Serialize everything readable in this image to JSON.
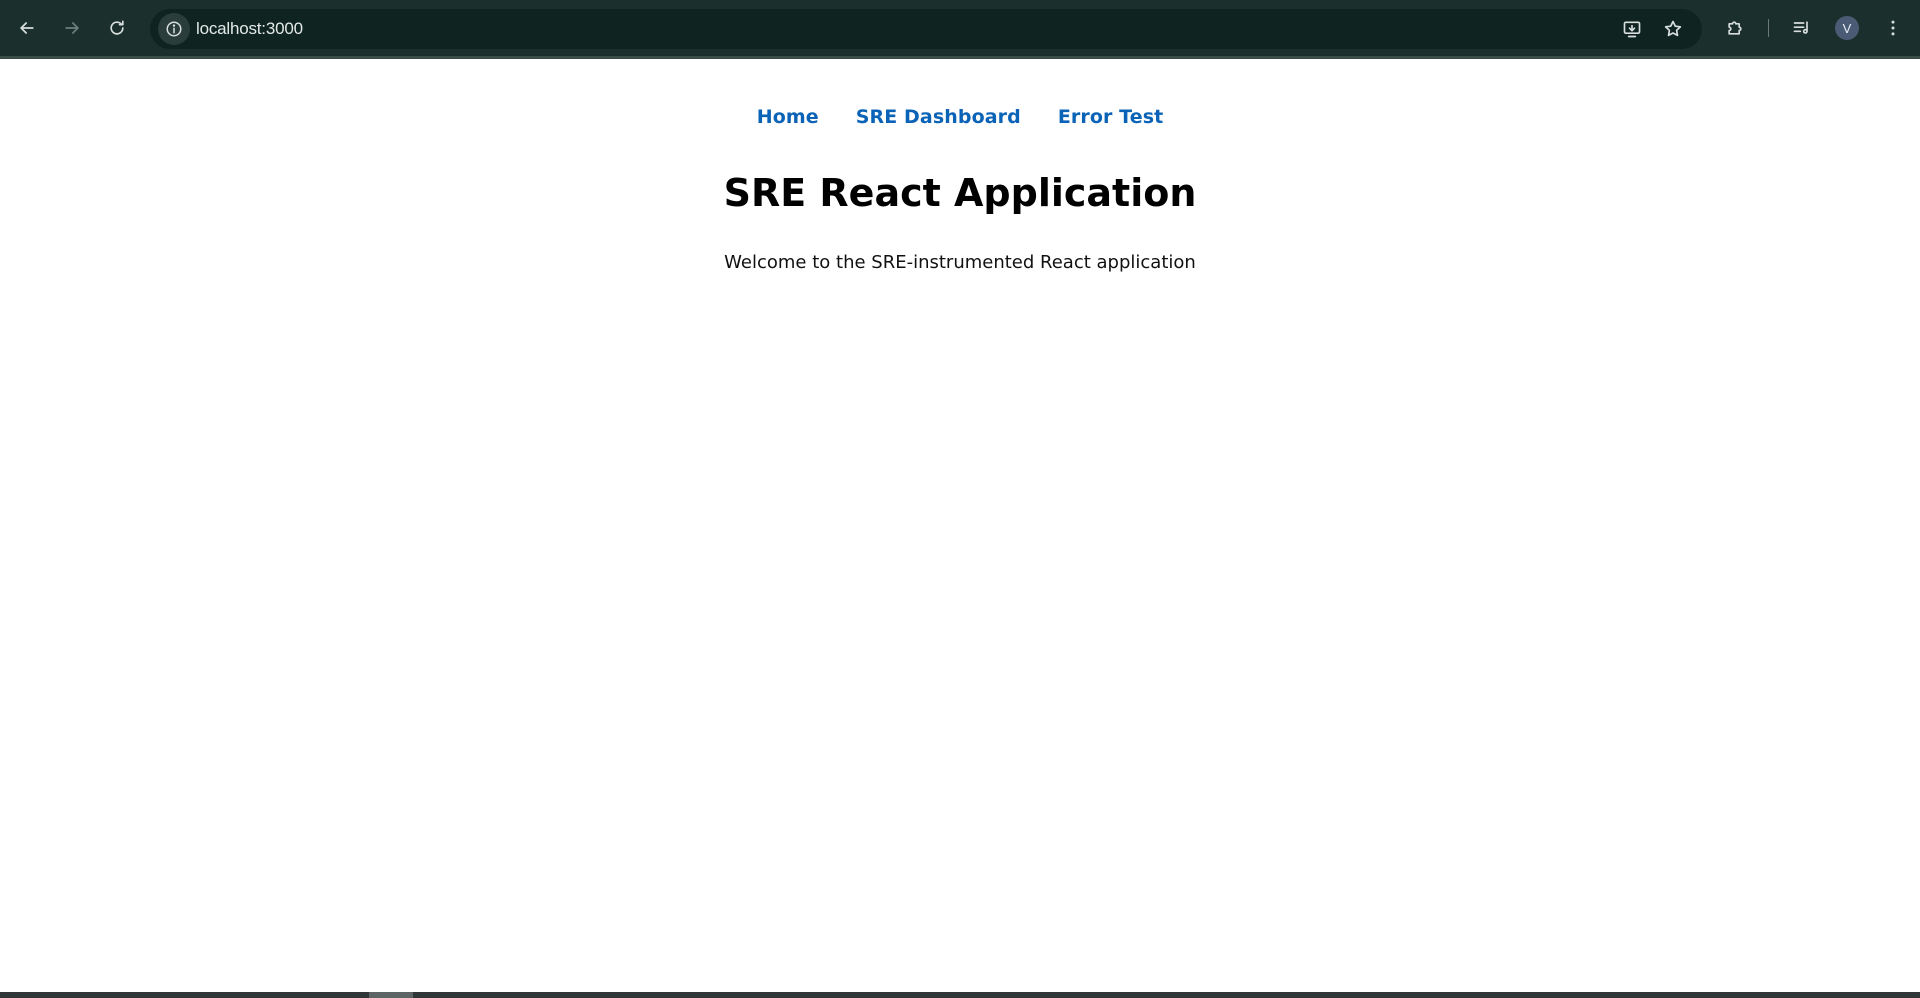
{
  "browser": {
    "url": "localhost:3000",
    "avatar_letter": "V",
    "colors": {
      "toolbar": "#1b2f2c",
      "omnibox": "#0f2421",
      "icon": "#d7dedc",
      "icon_disabled": "#6e7f7c"
    }
  },
  "app": {
    "nav": [
      {
        "label": "Home"
      },
      {
        "label": "SRE Dashboard"
      },
      {
        "label": "Error Test"
      }
    ],
    "title": "SRE React Application",
    "subtitle": "Welcome to the SRE-instrumented React application",
    "colors": {
      "link": "#0b63b7",
      "text": "#000000",
      "background": "#ffffff"
    }
  }
}
